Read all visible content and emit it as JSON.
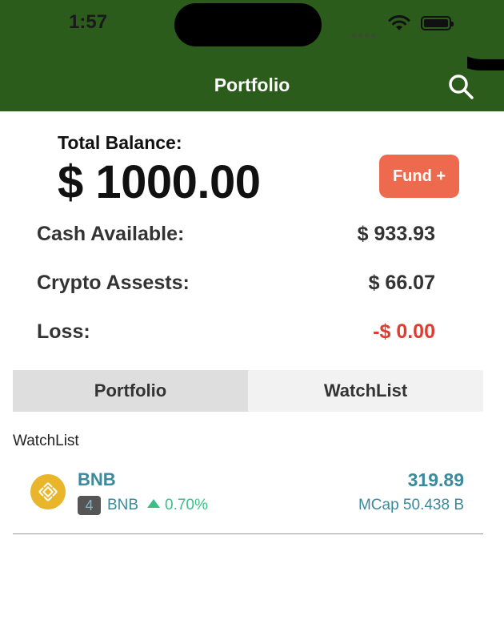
{
  "status_bar": {
    "time": "1:57"
  },
  "nav": {
    "title": "Portfolio",
    "search_icon": "search-icon"
  },
  "balance": {
    "label": "Total Balance:",
    "value": "$ 1000.00",
    "fund_button": "Fund +"
  },
  "stats": {
    "cash_label": "Cash Available:",
    "cash_value": "$ 933.93",
    "crypto_label": "Crypto Assests:",
    "crypto_value": "$ 66.07",
    "loss_label": "Loss:",
    "loss_value": "-$ 0.00"
  },
  "tabs": [
    {
      "label": "Portfolio",
      "selected": true
    },
    {
      "label": "WatchList",
      "selected": false
    }
  ],
  "watchlist": {
    "heading": "WatchList",
    "items": [
      {
        "name": "BNB",
        "rank": "4",
        "symbol": "BNB",
        "change": "0.70%",
        "price": "319.89",
        "mcap": "MCap 50.438 B",
        "logo_icon": "bnb-logo-icon"
      }
    ]
  },
  "colors": {
    "header": "#2b5c1c",
    "fund_button": "#ee6a4e",
    "loss": "#e03b2c",
    "coin_text": "#3a8a9c",
    "positive": "#3bbf86"
  }
}
